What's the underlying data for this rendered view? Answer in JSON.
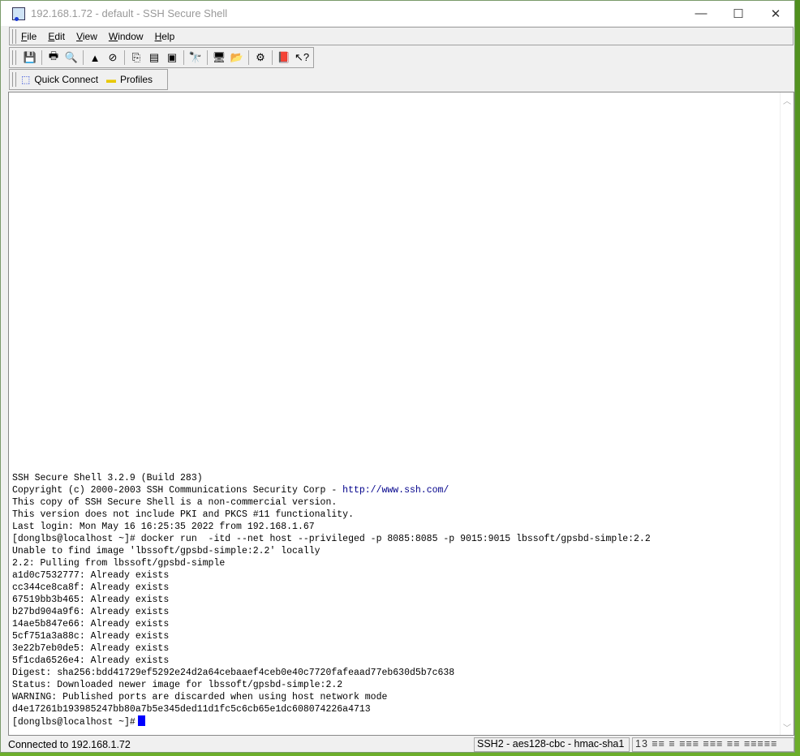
{
  "window": {
    "title": "192.168.1.72 - default - SSH Secure Shell",
    "minimize": "—",
    "maximize": "☐",
    "close": "✕"
  },
  "menu": [
    {
      "label": "File",
      "key": "F",
      "rest": "ile"
    },
    {
      "label": "Edit",
      "key": "E",
      "rest": "dit"
    },
    {
      "label": "View",
      "key": "V",
      "rest": "iew"
    },
    {
      "label": "Window",
      "key": "W",
      "rest": "indow"
    },
    {
      "label": "Help",
      "key": "H",
      "rest": "elp"
    }
  ],
  "toolbar": [
    {
      "icon": "save-icon",
      "glyph": "💾"
    },
    {
      "sep": true
    },
    {
      "icon": "print-icon",
      "glyph": "🖶"
    },
    {
      "icon": "print-preview-icon",
      "glyph": "🔍"
    },
    {
      "sep": true
    },
    {
      "icon": "connect-icon",
      "glyph": "▲"
    },
    {
      "icon": "disconnect-icon",
      "glyph": "⊘"
    },
    {
      "sep": true
    },
    {
      "icon": "copy-icon",
      "glyph": "⎘"
    },
    {
      "icon": "paste-icon",
      "glyph": "▤"
    },
    {
      "icon": "paste-special-icon",
      "glyph": "▣"
    },
    {
      "sep": true
    },
    {
      "icon": "find-icon",
      "glyph": "🔭"
    },
    {
      "sep": true
    },
    {
      "icon": "new-terminal-icon",
      "glyph": "🖥"
    },
    {
      "icon": "new-file-transfer-icon",
      "glyph": "📂"
    },
    {
      "sep": true
    },
    {
      "icon": "settings-icon",
      "glyph": "⚙"
    },
    {
      "sep": true
    },
    {
      "icon": "help-book-icon",
      "glyph": "📕"
    },
    {
      "icon": "context-help-icon",
      "glyph": "↖?"
    }
  ],
  "quickbar": {
    "quick_connect": "Quick Connect",
    "profiles": "Profiles"
  },
  "terminal": {
    "lines": [
      "SSH Secure Shell 3.2.9 (Build 283)",
      "Copyright (c) 2000-2003 SSH Communications Security Corp - ",
      "",
      "This copy of SSH Secure Shell is a non-commercial version.",
      "This version does not include PKI and PKCS #11 functionality.",
      "",
      "",
      "Last login: Mon May 16 16:25:35 2022 from 192.168.1.67",
      "[donglbs@localhost ~]# docker run  -itd --net host --privileged -p 8085:8085 -p 9015:9015 lbssoft/gpsbd-simple:2.2",
      "Unable to find image 'lbssoft/gpsbd-simple:2.2' locally",
      "2.2: Pulling from lbssoft/gpsbd-simple",
      "a1d0c7532777: Already exists",
      "cc344ce8ca8f: Already exists",
      "67519bb3b465: Already exists",
      "b27bd904a9f6: Already exists",
      "14ae5b847e66: Already exists",
      "5cf751a3a88c: Already exists",
      "3e22b7eb0de5: Already exists",
      "5f1cda6526e4: Already exists",
      "Digest: sha256:bdd41729ef5292e24d2a64cebaaef4ceb0e40c7720fafeaad77eb630d5b7c638",
      "Status: Downloaded newer image for lbssoft/gpsbd-simple:2.2",
      "WARNING: Published ports are discarded when using host network mode",
      "d4e17261b193985247bb80a7b5e345ded11d1fc5c6cb65e1dc608074226a4713"
    ],
    "link": "http://www.ssh.com/",
    "prompt": "[donglbs@localhost ~]#"
  },
  "status": {
    "connection": "Connected to 192.168.1.72",
    "cipher": "SSH2 - aes128-cbc - hmac-sha1",
    "size": "13 ≡≡ ≡ ≡≡≡ ≡≡≡ ≡≡ ≡≡≡≡≡ ≡≡≡"
  }
}
